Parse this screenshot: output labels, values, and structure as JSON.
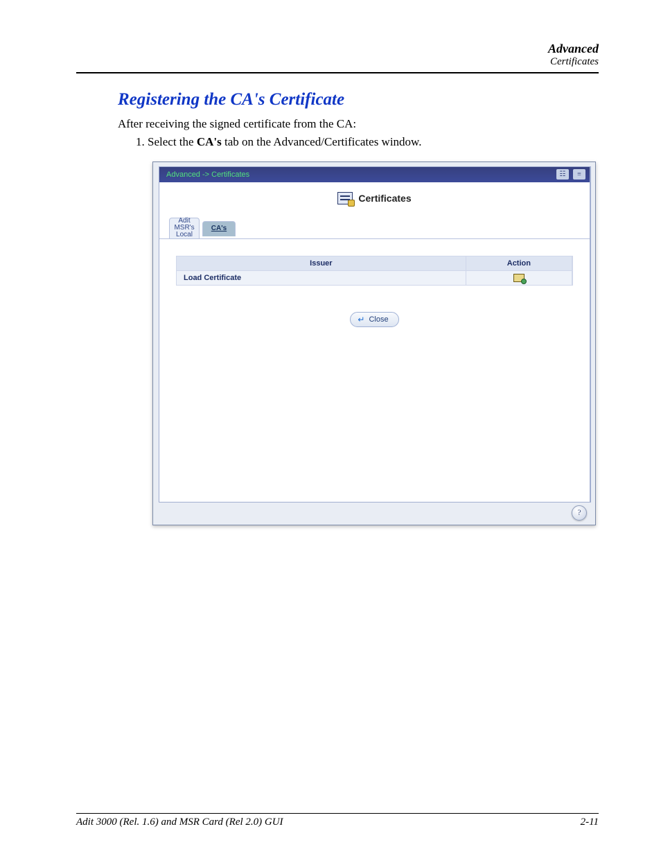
{
  "header": {
    "line1": "Advanced",
    "line2": "Certificates"
  },
  "section": {
    "title": "Registering the CA's Certificate",
    "intro": "After receiving the signed certificate from the CA:",
    "step_number": "1.",
    "step_before": "Select the ",
    "step_bold": "CA's",
    "step_after": " tab on the Advanced/Certificates window."
  },
  "screenshot": {
    "breadcrumb": "Advanced -> Certificates",
    "panel_title": "Certificates",
    "tabs": {
      "inactive": "Adit\nMSR's\nLocal",
      "active": "CA's"
    },
    "table": {
      "headers": {
        "issuer": "Issuer",
        "action": "Action"
      },
      "row": {
        "issuer": "Load Certificate"
      }
    },
    "close_label": "Close",
    "help": "?"
  },
  "footer": {
    "left": "Adit 3000 (Rel. 1.6) and MSR Card (Rel 2.0) GUI",
    "right": "2-11"
  }
}
